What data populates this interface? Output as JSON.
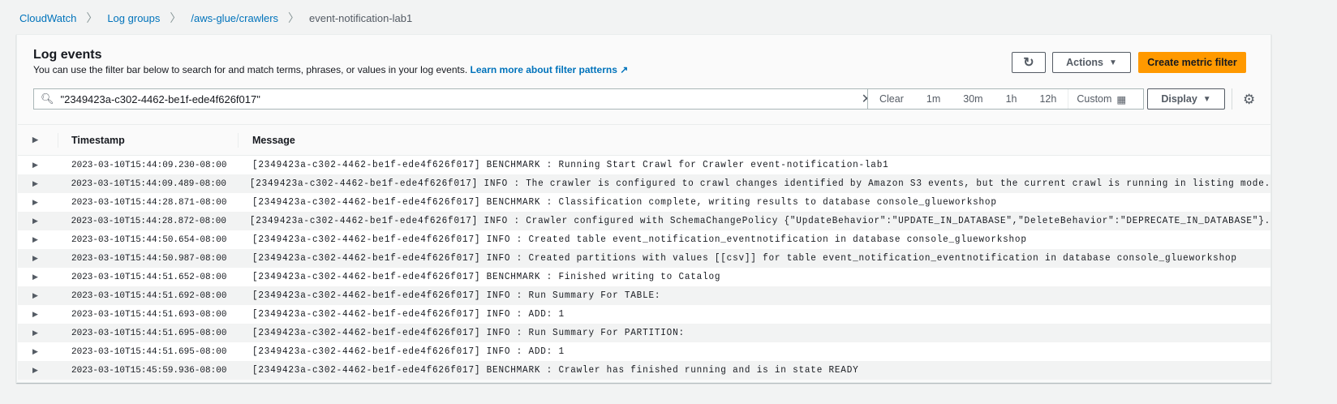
{
  "breadcrumb": [
    "CloudWatch",
    "Log groups",
    "/aws-glue/crawlers",
    "event-notification-lab1"
  ],
  "panel": {
    "title": "Log events",
    "description": "You can use the filter bar below to search for and match terms, phrases, or values in your log events.",
    "learn_more": "Learn more about filter patterns"
  },
  "toolbar": {
    "actions": "Actions",
    "create": "Create metric filter",
    "display": "Display",
    "accent": "#ff9900"
  },
  "filter": {
    "value": "\"2349423a-c302-4462-be1f-ede4f626f017\"",
    "ranges": [
      "Clear",
      "1m",
      "30m",
      "1h",
      "12h"
    ],
    "custom": "Custom"
  },
  "table": {
    "headers": [
      "Timestamp",
      "Message"
    ],
    "rows": [
      {
        "ts": "2023-03-10T15:44:09.230-08:00",
        "msg": "[2349423a-c302-4462-be1f-ede4f626f017] BENCHMARK : Running Start Crawl for Crawler event-notification-lab1"
      },
      {
        "ts": "2023-03-10T15:44:09.489-08:00",
        "msg": "[2349423a-c302-4462-be1f-ede4f626f017] INFO : The crawler is configured to crawl changes identified by Amazon S3 events, but the current crawl is running in listing mode."
      },
      {
        "ts": "2023-03-10T15:44:28.871-08:00",
        "msg": "[2349423a-c302-4462-be1f-ede4f626f017] BENCHMARK : Classification complete, writing results to database console_glueworkshop"
      },
      {
        "ts": "2023-03-10T15:44:28.872-08:00",
        "msg": "[2349423a-c302-4462-be1f-ede4f626f017] INFO : Crawler configured with SchemaChangePolicy {\"UpdateBehavior\":\"UPDATE_IN_DATABASE\",\"DeleteBehavior\":\"DEPRECATE_IN_DATABASE\"}."
      },
      {
        "ts": "2023-03-10T15:44:50.654-08:00",
        "msg": "[2349423a-c302-4462-be1f-ede4f626f017] INFO : Created table event_notification_eventnotification in database console_glueworkshop"
      },
      {
        "ts": "2023-03-10T15:44:50.987-08:00",
        "msg": "[2349423a-c302-4462-be1f-ede4f626f017] INFO : Created partitions with values [[csv]] for table event_notification_eventnotification in database console_glueworkshop"
      },
      {
        "ts": "2023-03-10T15:44:51.652-08:00",
        "msg": "[2349423a-c302-4462-be1f-ede4f626f017] BENCHMARK : Finished writing to Catalog"
      },
      {
        "ts": "2023-03-10T15:44:51.692-08:00",
        "msg": "[2349423a-c302-4462-be1f-ede4f626f017] INFO : Run Summary For TABLE:"
      },
      {
        "ts": "2023-03-10T15:44:51.693-08:00",
        "msg": "[2349423a-c302-4462-be1f-ede4f626f017] INFO : ADD: 1"
      },
      {
        "ts": "2023-03-10T15:44:51.695-08:00",
        "msg": "[2349423a-c302-4462-be1f-ede4f626f017] INFO : Run Summary For PARTITION:"
      },
      {
        "ts": "2023-03-10T15:44:51.695-08:00",
        "msg": "[2349423a-c302-4462-be1f-ede4f626f017] INFO : ADD: 1"
      },
      {
        "ts": "2023-03-10T15:45:59.936-08:00",
        "msg": "[2349423a-c302-4462-be1f-ede4f626f017] BENCHMARK : Crawler has finished running and is in state READY"
      }
    ]
  }
}
